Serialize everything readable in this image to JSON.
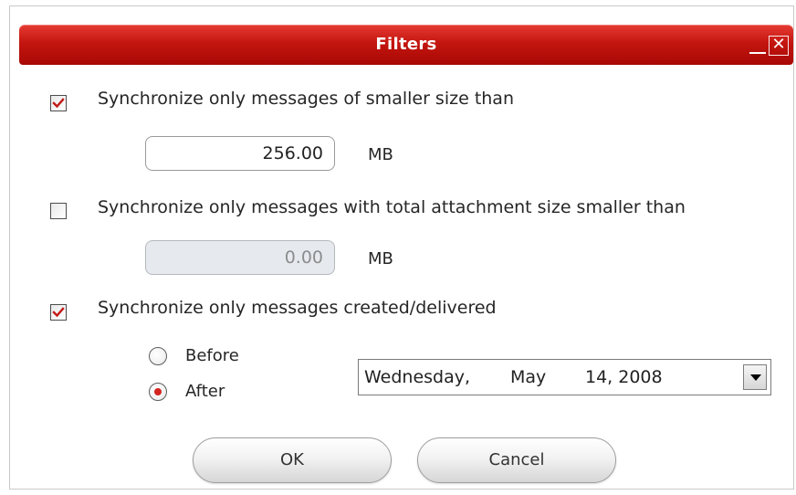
{
  "dialog": {
    "title": "Filters",
    "colors": {
      "titlebar": "#c4150f",
      "accent": "#d2231f"
    }
  },
  "window_controls": {
    "minimize_icon": "minimize-icon",
    "close_icon": "close-icon",
    "close_glyph": "✕"
  },
  "filters": {
    "size": {
      "checked": true,
      "label": "Synchronize only messages of smaller size than",
      "value": "256.00",
      "unit": "MB"
    },
    "attachment": {
      "checked": false,
      "label": "Synchronize only messages with total attachment size smaller than",
      "value": "0.00",
      "unit": "MB"
    },
    "date": {
      "checked": true,
      "label": "Synchronize only messages created/delivered",
      "options": [
        {
          "label": "Before",
          "selected": false
        },
        {
          "label": "After",
          "selected": true
        }
      ],
      "date_weekday": "Wednesday,",
      "date_month": "May",
      "date_day_year": "14, 2008"
    }
  },
  "buttons": {
    "ok": "OK",
    "cancel": "Cancel"
  }
}
